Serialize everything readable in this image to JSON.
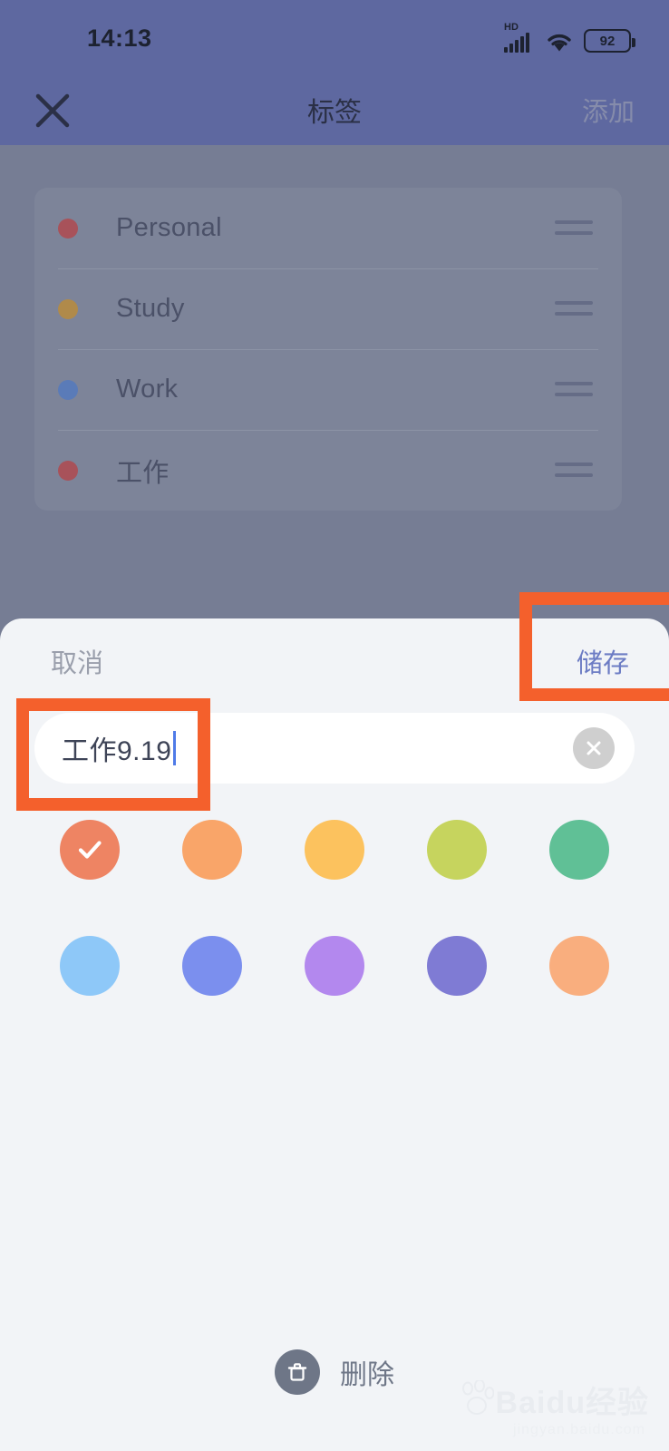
{
  "status_bar": {
    "time": "14:13",
    "network_type": "HD",
    "signal_icon": "signal-bars-icon",
    "wifi_icon": "wifi-icon",
    "battery_level": "92"
  },
  "nav_bar": {
    "close_icon": "close-icon",
    "title": "标签",
    "add_label": "添加"
  },
  "tag_list": {
    "items": [
      {
        "label": "Personal",
        "color": "#A8525A",
        "handle_icon": "drag-handle-icon"
      },
      {
        "label": "Study",
        "color": "#B08A4A",
        "handle_icon": "drag-handle-icon"
      },
      {
        "label": "Work",
        "color": "#5A7BB8",
        "handle_icon": "drag-handle-icon"
      },
      {
        "label": "工作",
        "color": "#A8525A",
        "handle_icon": "drag-handle-icon"
      }
    ]
  },
  "sheet": {
    "cancel_label": "取消",
    "save_label": "储存",
    "input": {
      "value": "工作9.19",
      "placeholder": "",
      "clear_icon": "clear-circle-icon",
      "caret_color": "#4F7BE8"
    },
    "colors": {
      "selected_index": 0,
      "check_icon": "check-icon",
      "row1": [
        "#EE8463",
        "#F9A569",
        "#FCC25E",
        "#C6D45E",
        "#60C096"
      ],
      "row2": [
        "#8EC8F8",
        "#7B8FEE",
        "#B388EE",
        "#7F7BD4",
        "#F9AE7E"
      ]
    },
    "delete": {
      "icon": "trash-icon",
      "label": "删除"
    }
  },
  "watermark": {
    "brand": "Baidu",
    "brand_cn": "经验",
    "url": "jingyan.baidu.com",
    "paw_icon": "paw-icon"
  },
  "annotations": {
    "highlight_color": "#F4602C",
    "boxes": [
      "save-button-highlight",
      "name-input-highlight"
    ]
  },
  "theme": {
    "header_bg": "#5E68A0",
    "dimmed_bg": "#767D94",
    "sheet_bg": "#F2F4F7",
    "save_blue": "#6C7CC4"
  }
}
